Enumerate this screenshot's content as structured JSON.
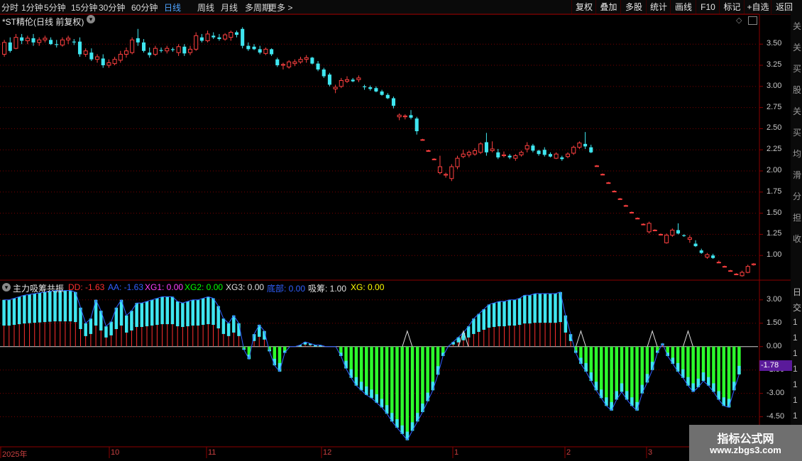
{
  "toolbar": {
    "periods": [
      "分时",
      "1分钟",
      "5分钟",
      "15分钟",
      "30分钟",
      "60分钟",
      "日线",
      "周线",
      "月线",
      "多周期",
      "更多 >"
    ],
    "active_period": "日线",
    "buttons": [
      "复权",
      "叠加",
      "多股",
      "统计",
      "画线",
      "F10",
      "标记",
      "+自选",
      "返回"
    ]
  },
  "main_title": "*ST精伦(日线 前复权)",
  "indicator": {
    "name": "主力吸筹共振",
    "values": [
      {
        "label": "DD: -1.63",
        "color": "#ff3030"
      },
      {
        "label": "AA: -1.63",
        "color": "#3060ff"
      },
      {
        "label": "XG1: 0.00",
        "color": "#ff40ff"
      },
      {
        "label": "XG2: 0.00",
        "color": "#00ff00"
      },
      {
        "label": "XG3: 0.00",
        "color": "#e0e0e0"
      },
      {
        "label": "底部: 0.00",
        "color": "#3060ff"
      },
      {
        "label": "吸筹: 1.00",
        "color": "#e0e0e0"
      },
      {
        "label": "XG: 0.00",
        "color": "#ffff00"
      }
    ],
    "current_value": "-1.78"
  },
  "side_chars": [
    "关",
    "关",
    "买",
    "股",
    "关",
    "买",
    "均",
    "滑",
    "分",
    "担",
    "收"
  ],
  "side_chars_lower": [
    "日",
    "交",
    "1",
    "1",
    "1",
    "1",
    "1",
    "1",
    "1",
    "1"
  ],
  "watermark": {
    "line1": "指标公式网",
    "line2": "www.zbgs3.com"
  },
  "x_labels": [
    "2025年",
    "10",
    "11",
    "12",
    "1",
    "2",
    "3"
  ],
  "chart_data": [
    {
      "type": "candlestick",
      "title": "*ST精伦(日线 前复权)",
      "y_ticks": [
        "3.50",
        "3.25",
        "3.00",
        "2.75",
        "2.50",
        "2.25",
        "2.00",
        "1.75",
        "1.50",
        "1.25",
        "1.00"
      ],
      "ylim": [
        0.75,
        3.72
      ],
      "colors": {
        "up": "#ff4040",
        "down": "#3fe6f0"
      },
      "candles": [
        {
          "o": 3.38,
          "h": 3.55,
          "l": 3.35,
          "c": 3.52
        },
        {
          "o": 3.52,
          "h": 3.58,
          "l": 3.4,
          "c": 3.42
        },
        {
          "o": 3.45,
          "h": 3.62,
          "l": 3.44,
          "c": 3.58
        },
        {
          "o": 3.58,
          "h": 3.62,
          "l": 3.5,
          "c": 3.54
        },
        {
          "o": 3.54,
          "h": 3.6,
          "l": 3.5,
          "c": 3.57
        },
        {
          "o": 3.57,
          "h": 3.62,
          "l": 3.48,
          "c": 3.52
        },
        {
          "o": 3.52,
          "h": 3.58,
          "l": 3.48,
          "c": 3.55
        },
        {
          "o": 3.55,
          "h": 3.6,
          "l": 3.52,
          "c": 3.57
        },
        {
          "o": 3.55,
          "h": 3.58,
          "l": 3.49,
          "c": 3.5
        },
        {
          "o": 3.5,
          "h": 3.55,
          "l": 3.46,
          "c": 3.49
        },
        {
          "o": 3.49,
          "h": 3.58,
          "l": 3.47,
          "c": 3.55
        },
        {
          "o": 3.55,
          "h": 3.6,
          "l": 3.5,
          "c": 3.57
        },
        {
          "o": 3.53,
          "h": 3.56,
          "l": 3.49,
          "c": 3.52
        },
        {
          "o": 3.53,
          "h": 3.58,
          "l": 3.35,
          "c": 3.38
        },
        {
          "o": 3.38,
          "h": 3.45,
          "l": 3.35,
          "c": 3.42
        },
        {
          "o": 3.4,
          "h": 3.45,
          "l": 3.3,
          "c": 3.32
        },
        {
          "o": 3.32,
          "h": 3.38,
          "l": 3.28,
          "c": 3.35
        },
        {
          "o": 3.33,
          "h": 3.38,
          "l": 3.22,
          "c": 3.25
        },
        {
          "o": 3.25,
          "h": 3.32,
          "l": 3.22,
          "c": 3.28
        },
        {
          "o": 3.27,
          "h": 3.35,
          "l": 3.25,
          "c": 3.32
        },
        {
          "o": 3.31,
          "h": 3.42,
          "l": 3.28,
          "c": 3.38
        },
        {
          "o": 3.38,
          "h": 3.46,
          "l": 3.34,
          "c": 3.42
        },
        {
          "o": 3.4,
          "h": 3.58,
          "l": 3.38,
          "c": 3.55
        },
        {
          "o": 3.57,
          "h": 3.68,
          "l": 3.48,
          "c": 3.52
        },
        {
          "o": 3.52,
          "h": 3.56,
          "l": 3.4,
          "c": 3.42
        },
        {
          "o": 3.4,
          "h": 3.46,
          "l": 3.34,
          "c": 3.37
        },
        {
          "o": 3.38,
          "h": 3.48,
          "l": 3.36,
          "c": 3.45
        },
        {
          "o": 3.43,
          "h": 3.46,
          "l": 3.4,
          "c": 3.42
        },
        {
          "o": 3.42,
          "h": 3.48,
          "l": 3.39,
          "c": 3.45
        },
        {
          "o": 3.44,
          "h": 3.46,
          "l": 3.41,
          "c": 3.43
        },
        {
          "o": 3.4,
          "h": 3.5,
          "l": 3.36,
          "c": 3.47
        },
        {
          "o": 3.47,
          "h": 3.5,
          "l": 3.36,
          "c": 3.39
        },
        {
          "o": 3.4,
          "h": 3.48,
          "l": 3.37,
          "c": 3.44
        },
        {
          "o": 3.44,
          "h": 3.64,
          "l": 3.42,
          "c": 3.6
        },
        {
          "o": 3.58,
          "h": 3.62,
          "l": 3.52,
          "c": 3.54
        },
        {
          "o": 3.54,
          "h": 3.66,
          "l": 3.52,
          "c": 3.62
        },
        {
          "o": 3.6,
          "h": 3.64,
          "l": 3.56,
          "c": 3.58
        },
        {
          "o": 3.58,
          "h": 3.62,
          "l": 3.54,
          "c": 3.56
        },
        {
          "o": 3.56,
          "h": 3.63,
          "l": 3.54,
          "c": 3.61
        },
        {
          "o": 3.58,
          "h": 3.66,
          "l": 3.54,
          "c": 3.64
        },
        {
          "o": 3.64,
          "h": 3.66,
          "l": 3.58,
          "c": 3.61
        },
        {
          "o": 3.68,
          "h": 3.7,
          "l": 3.45,
          "c": 3.48
        },
        {
          "o": 3.48,
          "h": 3.52,
          "l": 3.42,
          "c": 3.44
        },
        {
          "o": 3.47,
          "h": 3.5,
          "l": 3.43,
          "c": 3.44
        },
        {
          "o": 3.44,
          "h": 3.48,
          "l": 3.38,
          "c": 3.4
        },
        {
          "o": 3.39,
          "h": 3.46,
          "l": 3.37,
          "c": 3.44
        },
        {
          "o": 3.44,
          "h": 3.45,
          "l": 3.36,
          "c": 3.38
        },
        {
          "o": 3.32,
          "h": 3.34,
          "l": 3.23,
          "c": 3.25
        },
        {
          "o": 3.25,
          "h": 3.28,
          "l": 3.2,
          "c": 3.26
        },
        {
          "o": 3.23,
          "h": 3.31,
          "l": 3.21,
          "c": 3.29
        },
        {
          "o": 3.27,
          "h": 3.32,
          "l": 3.24,
          "c": 3.29
        },
        {
          "o": 3.29,
          "h": 3.35,
          "l": 3.27,
          "c": 3.32
        },
        {
          "o": 3.32,
          "h": 3.37,
          "l": 3.28,
          "c": 3.34
        },
        {
          "o": 3.34,
          "h": 3.35,
          "l": 3.26,
          "c": 3.27
        },
        {
          "o": 3.27,
          "h": 3.3,
          "l": 3.18,
          "c": 3.2
        },
        {
          "o": 3.2,
          "h": 3.22,
          "l": 3.1,
          "c": 3.12
        },
        {
          "o": 3.14,
          "h": 3.16,
          "l": 3.0,
          "c": 3.02
        },
        {
          "o": 2.97,
          "h": 3.02,
          "l": 2.92,
          "c": 2.99
        },
        {
          "o": 3.0,
          "h": 3.1,
          "l": 2.98,
          "c": 3.07
        },
        {
          "o": 3.06,
          "h": 3.12,
          "l": 3.04,
          "c": 3.08
        },
        {
          "o": 3.08,
          "h": 3.1,
          "l": 3.05,
          "c": 3.06
        },
        {
          "o": 3.08,
          "h": 3.13,
          "l": 3.05,
          "c": 3.1
        },
        {
          "o": 3.0,
          "h": 3.02,
          "l": 2.96,
          "c": 2.99
        },
        {
          "o": 2.99,
          "h": 3.01,
          "l": 2.95,
          "c": 2.97
        },
        {
          "o": 2.98,
          "h": 3.0,
          "l": 2.93,
          "c": 2.94
        },
        {
          "o": 2.94,
          "h": 2.96,
          "l": 2.89,
          "c": 2.9
        },
        {
          "o": 2.9,
          "h": 2.92,
          "l": 2.85,
          "c": 2.86
        },
        {
          "o": 2.86,
          "h": 2.88,
          "l": 2.74,
          "c": 2.77
        },
        {
          "o": 2.64,
          "h": 2.68,
          "l": 2.6,
          "c": 2.66
        },
        {
          "o": 2.64,
          "h": 2.67,
          "l": 2.61,
          "c": 2.65
        },
        {
          "o": 2.66,
          "h": 2.72,
          "l": 2.61,
          "c": 2.63
        },
        {
          "o": 2.62,
          "h": 2.64,
          "l": 2.43,
          "c": 2.47
        },
        {
          "o": 2.37,
          "h": 2.38,
          "l": 2.36,
          "c": 2.37
        },
        {
          "o": 2.24,
          "h": 2.25,
          "l": 2.23,
          "c": 2.24
        },
        {
          "o": 2.14,
          "h": 2.15,
          "l": 2.13,
          "c": 2.14
        },
        {
          "o": 1.98,
          "h": 2.18,
          "l": 1.96,
          "c": 2.05
        },
        {
          "o": 1.95,
          "h": 1.98,
          "l": 1.92,
          "c": 1.96
        },
        {
          "o": 1.91,
          "h": 2.08,
          "l": 1.88,
          "c": 2.05
        },
        {
          "o": 2.05,
          "h": 2.18,
          "l": 2.02,
          "c": 2.15
        },
        {
          "o": 2.17,
          "h": 2.25,
          "l": 2.15,
          "c": 2.2
        },
        {
          "o": 2.19,
          "h": 2.24,
          "l": 2.16,
          "c": 2.22
        },
        {
          "o": 2.2,
          "h": 2.27,
          "l": 2.18,
          "c": 2.24
        },
        {
          "o": 2.22,
          "h": 2.34,
          "l": 2.2,
          "c": 2.32
        },
        {
          "o": 2.34,
          "h": 2.45,
          "l": 2.18,
          "c": 2.22
        },
        {
          "o": 2.24,
          "h": 2.35,
          "l": 2.22,
          "c": 2.26
        },
        {
          "o": 2.22,
          "h": 2.26,
          "l": 2.14,
          "c": 2.16
        },
        {
          "o": 2.18,
          "h": 2.23,
          "l": 2.16,
          "c": 2.19
        },
        {
          "o": 2.18,
          "h": 2.2,
          "l": 2.14,
          "c": 2.16
        },
        {
          "o": 2.15,
          "h": 2.2,
          "l": 2.12,
          "c": 2.18
        },
        {
          "o": 2.19,
          "h": 2.24,
          "l": 2.17,
          "c": 2.22
        },
        {
          "o": 2.26,
          "h": 2.34,
          "l": 2.22,
          "c": 2.3
        },
        {
          "o": 2.3,
          "h": 2.32,
          "l": 2.22,
          "c": 2.24
        },
        {
          "o": 2.24,
          "h": 2.25,
          "l": 2.18,
          "c": 2.2
        },
        {
          "o": 2.25,
          "h": 2.28,
          "l": 2.17,
          "c": 2.19
        },
        {
          "o": 2.2,
          "h": 2.22,
          "l": 2.16,
          "c": 2.17
        },
        {
          "o": 2.15,
          "h": 2.22,
          "l": 2.14,
          "c": 2.2
        },
        {
          "o": 2.16,
          "h": 2.18,
          "l": 2.12,
          "c": 2.14
        },
        {
          "o": 2.17,
          "h": 2.22,
          "l": 2.15,
          "c": 2.2
        },
        {
          "o": 2.21,
          "h": 2.3,
          "l": 2.19,
          "c": 2.28
        },
        {
          "o": 2.28,
          "h": 2.35,
          "l": 2.26,
          "c": 2.33
        },
        {
          "o": 2.32,
          "h": 2.46,
          "l": 2.26,
          "c": 2.29
        },
        {
          "o": 2.28,
          "h": 2.31,
          "l": 2.21,
          "c": 2.22
        },
        {
          "o": 2.06,
          "h": 2.07,
          "l": 2.05,
          "c": 2.06
        },
        {
          "o": 1.96,
          "h": 1.97,
          "l": 1.95,
          "c": 1.96
        },
        {
          "o": 1.86,
          "h": 1.87,
          "l": 1.85,
          "c": 1.86
        },
        {
          "o": 1.76,
          "h": 1.77,
          "l": 1.75,
          "c": 1.76
        },
        {
          "o": 1.67,
          "h": 1.68,
          "l": 1.66,
          "c": 1.67
        },
        {
          "o": 1.59,
          "h": 1.6,
          "l": 1.58,
          "c": 1.59
        },
        {
          "o": 1.51,
          "h": 1.52,
          "l": 1.5,
          "c": 1.51
        },
        {
          "o": 1.44,
          "h": 1.45,
          "l": 1.43,
          "c": 1.44
        },
        {
          "o": 1.37,
          "h": 1.38,
          "l": 1.36,
          "c": 1.37
        },
        {
          "o": 1.28,
          "h": 1.4,
          "l": 1.26,
          "c": 1.38
        },
        {
          "o": 1.3,
          "h": 1.31,
          "l": 1.29,
          "c": 1.3
        },
        {
          "o": 1.25,
          "h": 1.26,
          "l": 1.24,
          "c": 1.25
        },
        {
          "o": 1.15,
          "h": 1.26,
          "l": 1.14,
          "c": 1.24
        },
        {
          "o": 1.24,
          "h": 1.32,
          "l": 1.22,
          "c": 1.3
        },
        {
          "o": 1.3,
          "h": 1.38,
          "l": 1.25,
          "c": 1.26
        },
        {
          "o": 1.24,
          "h": 1.25,
          "l": 1.22,
          "c": 1.23
        },
        {
          "o": 1.19,
          "h": 1.24,
          "l": 1.15,
          "c": 1.21
        },
        {
          "o": 1.14,
          "h": 1.18,
          "l": 1.1,
          "c": 1.11
        },
        {
          "o": 1.06,
          "h": 1.08,
          "l": 1.02,
          "c": 1.03
        },
        {
          "o": 0.98,
          "h": 1.03,
          "l": 0.96,
          "c": 1.01
        },
        {
          "o": 1.0,
          "h": 1.02,
          "l": 0.96,
          "c": 0.97
        },
        {
          "o": 0.92,
          "h": 0.94,
          "l": 0.91,
          "c": 0.92
        },
        {
          "o": 0.87,
          "h": 0.88,
          "l": 0.86,
          "c": 0.87
        },
        {
          "o": 0.82,
          "h": 0.83,
          "l": 0.81,
          "c": 0.82
        },
        {
          "o": 0.78,
          "h": 0.79,
          "l": 0.77,
          "c": 0.78
        },
        {
          "o": 0.76,
          "h": 0.82,
          "l": 0.75,
          "c": 0.8
        },
        {
          "o": 0.8,
          "h": 0.89,
          "l": 0.79,
          "c": 0.87
        },
        {
          "o": 0.89,
          "h": 0.91,
          "l": 0.88,
          "c": 0.9
        }
      ]
    },
    {
      "type": "bar",
      "title": "主力吸筹共振",
      "y_ticks": [
        "3.00",
        "1.50",
        "0.00",
        "-1.50",
        "-3.00",
        "-4.50"
      ],
      "ylim": [
        -6.2,
        3.9
      ],
      "colors": {
        "positive": "#3fe6f0",
        "negative": "#2cff2c",
        "red_line": "#ff3030",
        "blue_line": "#3060ff",
        "white_line": "#e0e0e0"
      },
      "values": [
        3.0,
        3.0,
        3.1,
        3.2,
        3.3,
        3.35,
        3.4,
        3.45,
        3.5,
        3.55,
        3.6,
        3.6,
        3.6,
        3.6,
        3.5,
        2.5,
        1.5,
        1.8,
        3.0,
        2.3,
        1.3,
        1.6,
        2.5,
        3.0,
        2.0,
        2.3,
        2.8,
        2.8,
        2.9,
        3.0,
        3.1,
        3.2,
        3.2,
        3.2,
        2.9,
        2.8,
        2.9,
        3.0,
        3.0,
        3.1,
        3.2,
        3.1,
        2.6,
        1.8,
        1.5,
        2.0,
        1.5,
        -0.2,
        -0.8,
        0.8,
        1.4,
        1.0,
        -0.3,
        -1.2,
        -1.6,
        -0.4,
        0.0,
        0.0,
        0.1,
        0.3,
        0.2,
        0.1,
        0.1,
        0.0,
        0.0,
        0.0,
        -0.6,
        -1.4,
        -2.0,
        -2.5,
        -2.8,
        -3.1,
        -3.3,
        -3.6,
        -3.9,
        -4.3,
        -4.8,
        -5.2,
        -5.6,
        -6.0,
        -5.4,
        -4.8,
        -4.2,
        -3.5,
        -2.8,
        -1.8,
        -0.6,
        0.0,
        0.3,
        0.6,
        0.9,
        1.3,
        1.8,
        2.1,
        2.4,
        2.7,
        2.8,
        2.9,
        2.9,
        3.0,
        3.0,
        3.1,
        3.3,
        3.3,
        3.4,
        3.4,
        3.4,
        3.4,
        3.4,
        3.5,
        2.0,
        0.8,
        -0.4,
        -1.1,
        -1.6,
        -2.2,
        -2.8,
        -3.3,
        -3.8,
        -4.1,
        -3.4,
        -2.9,
        -3.4,
        -3.8,
        -4.1,
        -3.0,
        -2.3,
        -1.5,
        -0.4,
        0.2,
        -0.6,
        -1.1,
        -1.6,
        -2.0,
        -2.5,
        -2.9,
        -2.6,
        -2.2,
        -2.5,
        -2.9,
        -3.4,
        -3.8,
        -3.9,
        -2.8,
        -1.78
      ],
      "xg_triangles_at": [
        79,
        90,
        113,
        127,
        134
      ],
      "zero_label": "0.00"
    }
  ]
}
